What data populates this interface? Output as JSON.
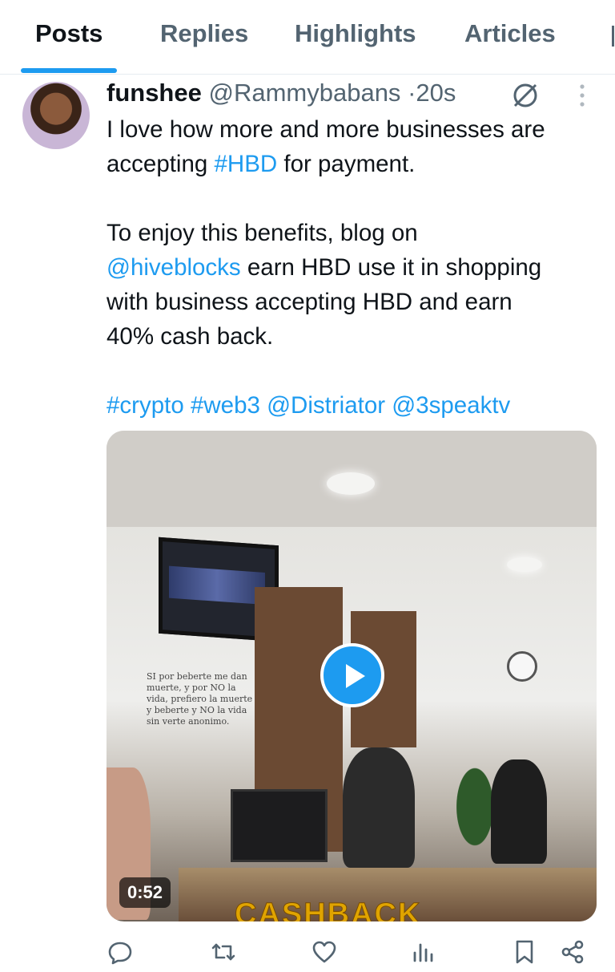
{
  "tabs": [
    {
      "label": "Posts",
      "active": true
    },
    {
      "label": "Replies",
      "active": false
    },
    {
      "label": "Highlights",
      "active": false
    },
    {
      "label": "Articles",
      "active": false
    }
  ],
  "post": {
    "author_name": "funshee",
    "author_handle": "@Rammybabans",
    "separator": "·",
    "time": "20s",
    "text_lines": [
      {
        "parts": [
          {
            "t": "I love how more and more businesses are",
            "link": false
          }
        ]
      },
      {
        "parts": [
          {
            "t": "accepting ",
            "link": false
          },
          {
            "t": "#HBD",
            "link": true
          },
          {
            "t": " for payment.",
            "link": false
          }
        ]
      },
      {
        "parts": []
      },
      {
        "parts": [
          {
            "t": "To enjoy this benefits, blog on",
            "link": false
          }
        ]
      },
      {
        "parts": [
          {
            "t": "@hiveblocks",
            "link": true
          },
          {
            "t": " earn HBD use it in shopping",
            "link": false
          }
        ]
      },
      {
        "parts": [
          {
            "t": "with business accepting HBD and earn",
            "link": false
          }
        ]
      },
      {
        "parts": [
          {
            "t": "40% cash back.",
            "link": false
          }
        ]
      },
      {
        "parts": []
      },
      {
        "parts": [
          {
            "t": "#crypto",
            "link": true
          },
          {
            "t": " ",
            "link": false
          },
          {
            "t": "#web3",
            "link": true
          },
          {
            "t": " ",
            "link": false
          },
          {
            "t": "@Distriator",
            "link": true
          },
          {
            "t": " ",
            "link": false
          },
          {
            "t": "@3speaktv",
            "link": true
          }
        ]
      }
    ],
    "video": {
      "duration": "0:52",
      "overlay_text": "CASHBACK",
      "wall_sign": "SI por beberte me dan muerte, y por NO la vida, prefiero la muerte y beberte y NO la vida sin verte anonimo."
    }
  },
  "icons": {
    "more": "more-vertical-icon",
    "grok": "grok-icon",
    "reply": "reply-icon",
    "repost": "repost-icon",
    "like": "like-icon",
    "views": "views-icon",
    "bookmark": "bookmark-icon",
    "share": "share-icon",
    "play": "play-icon"
  },
  "colors": {
    "accent": "#1d9bf0",
    "text": "#0f1419",
    "muted": "#536471"
  }
}
